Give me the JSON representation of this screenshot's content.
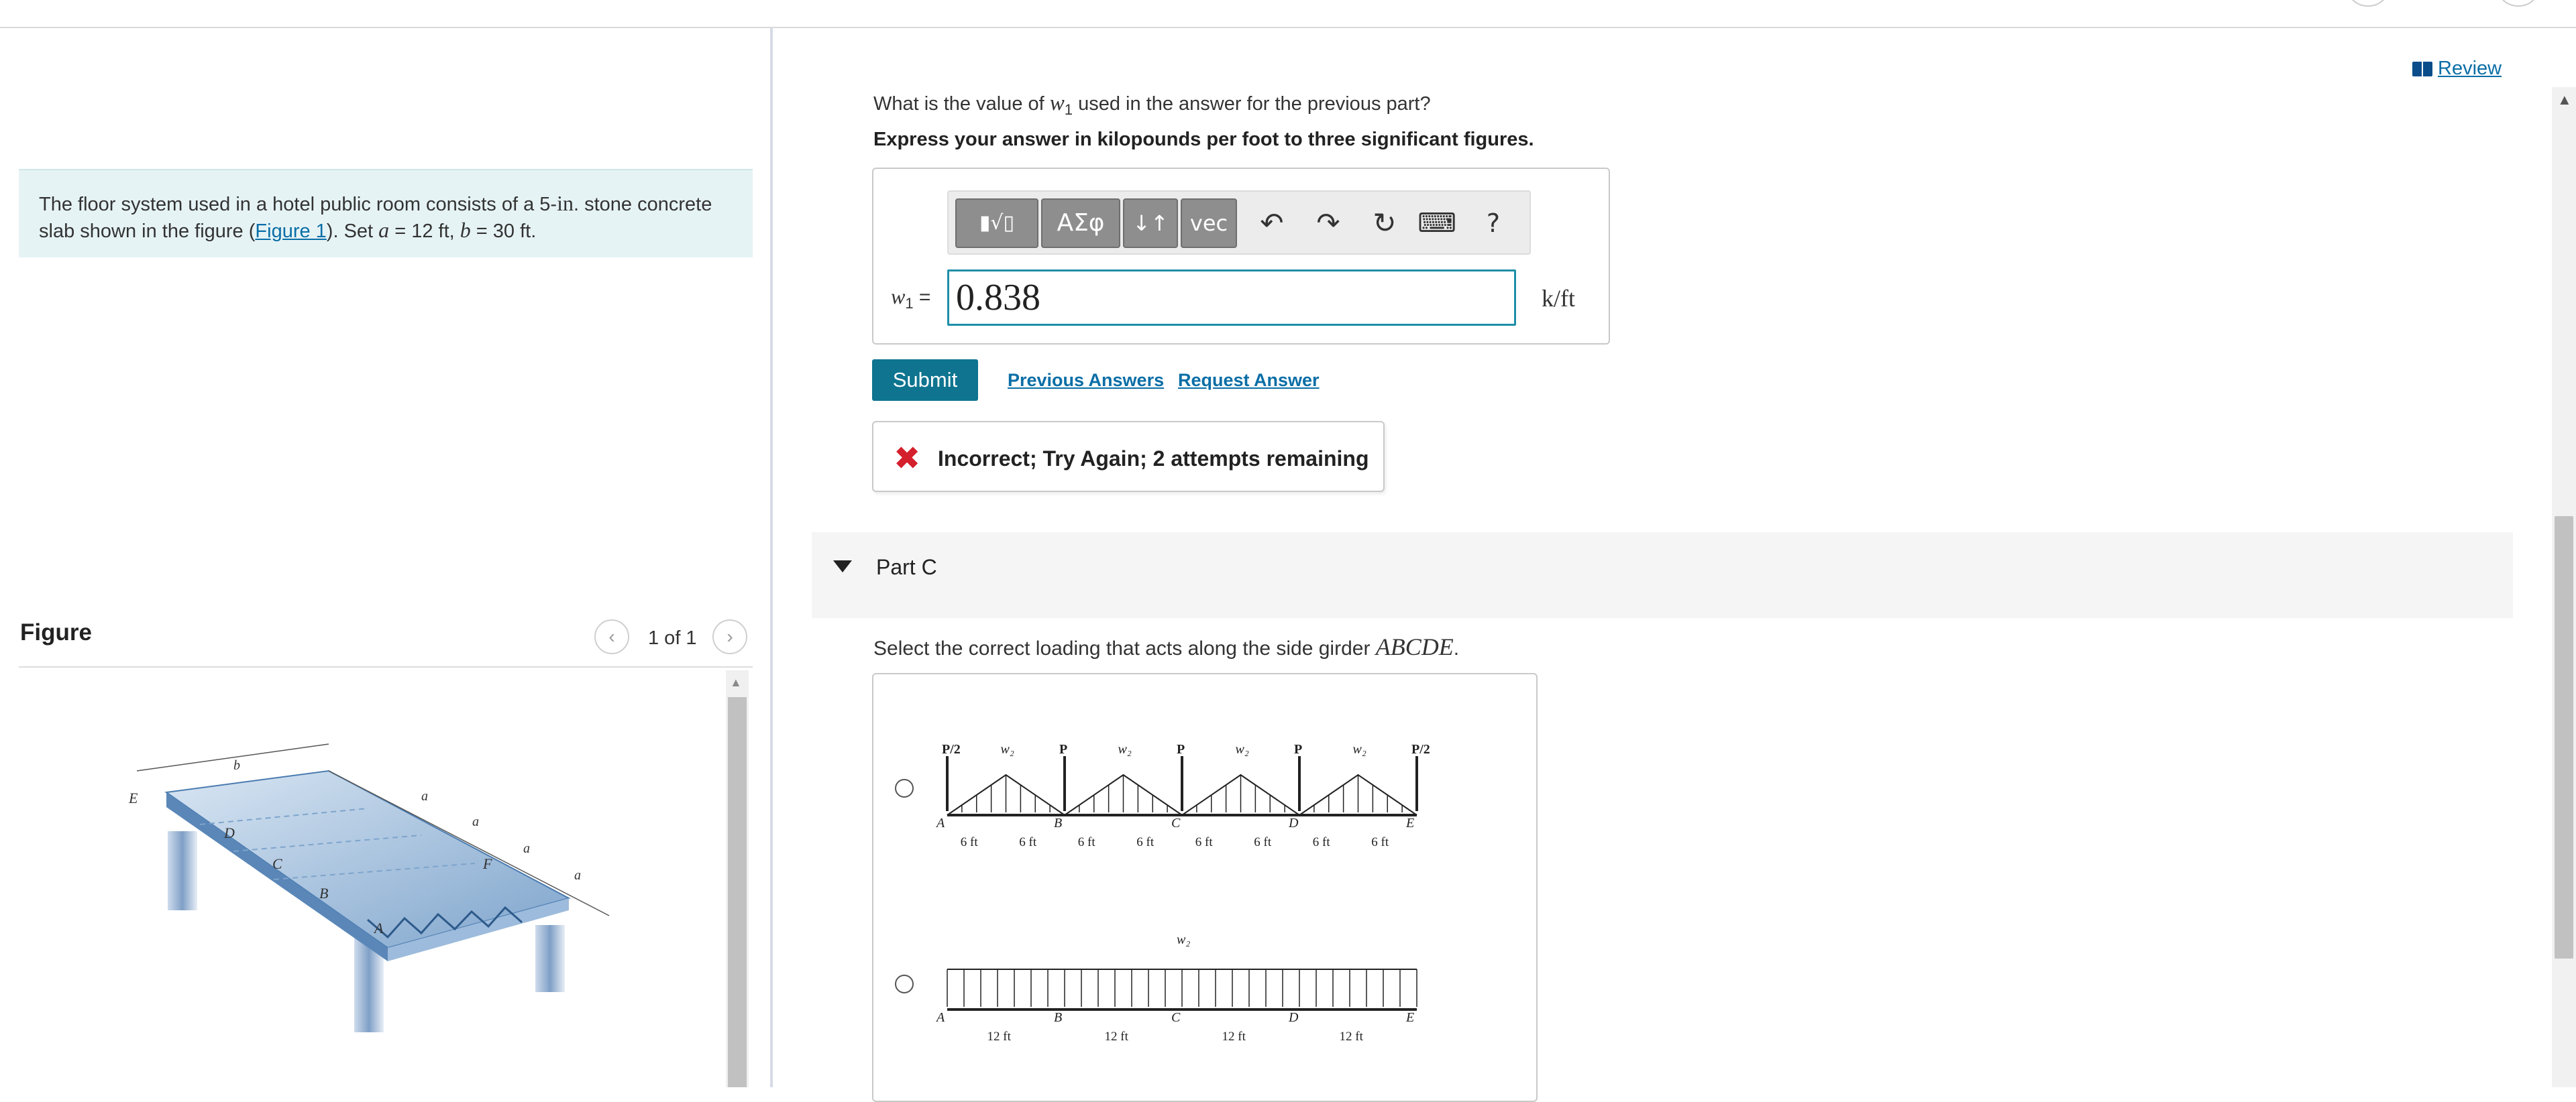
{
  "problem": {
    "intro_pre": "The floor system used in a hotel public room consists of a 5-",
    "intro_unit": "in",
    "intro_mid": ". stone concrete slab shown in the figure (",
    "figure_link": "Figure 1",
    "intro_post": "). Set ",
    "a_var": "a",
    "a_val": " = 12 ft, ",
    "b_var": "b",
    "b_val": " = 30 ft."
  },
  "figure": {
    "title": "Figure",
    "counter": "1 of 1",
    "labels": {
      "E": "E",
      "D": "D",
      "C": "C",
      "B": "B",
      "A": "A",
      "F": "F",
      "a": "a",
      "b": "b"
    }
  },
  "review": {
    "label": "Review"
  },
  "partB": {
    "question_pre": "What is the value of ",
    "var": "w",
    "var_sub": "1",
    "question_post": " used in the answer for the previous part?",
    "instruction": "Express your answer in kilopounds per foot to three significant figures.",
    "toolbar": {
      "templates": "▮√▯",
      "greek": "ΑΣφ",
      "arrows": "↓↑",
      "vec": "vec",
      "undo": "↶",
      "redo": "↷",
      "reset": "↻",
      "keyboard": "⌨",
      "help": "?"
    },
    "label": "w",
    "label_sub": "1",
    "label_eq": " =",
    "answer_value": "0.838",
    "unit": "k/ft",
    "submit": "Submit",
    "previous_answers": "Previous Answers",
    "request_answer": "Request Answer",
    "feedback_icon": "✖",
    "feedback": "Incorrect; Try Again; 2 attempts remaining"
  },
  "partC": {
    "title": "Part C",
    "question_pre": "Select the correct loading that acts along the side girder ",
    "girder": "ABCDE",
    "question_post": ".",
    "option1": {
      "loads": [
        "P/2",
        "w2",
        "P",
        "w2",
        "P",
        "w2",
        "P",
        "w2",
        "P/2"
      ],
      "supports": [
        "A",
        "B",
        "C",
        "D",
        "E"
      ],
      "dims": [
        "6 ft",
        "6 ft",
        "6 ft",
        "6 ft",
        "6 ft",
        "6 ft",
        "6 ft",
        "6 ft"
      ]
    },
    "option2": {
      "load": "w2",
      "supports": [
        "A",
        "B",
        "C",
        "D",
        "E"
      ],
      "dims": [
        "12 ft",
        "12 ft",
        "12 ft",
        "12 ft"
      ]
    }
  }
}
